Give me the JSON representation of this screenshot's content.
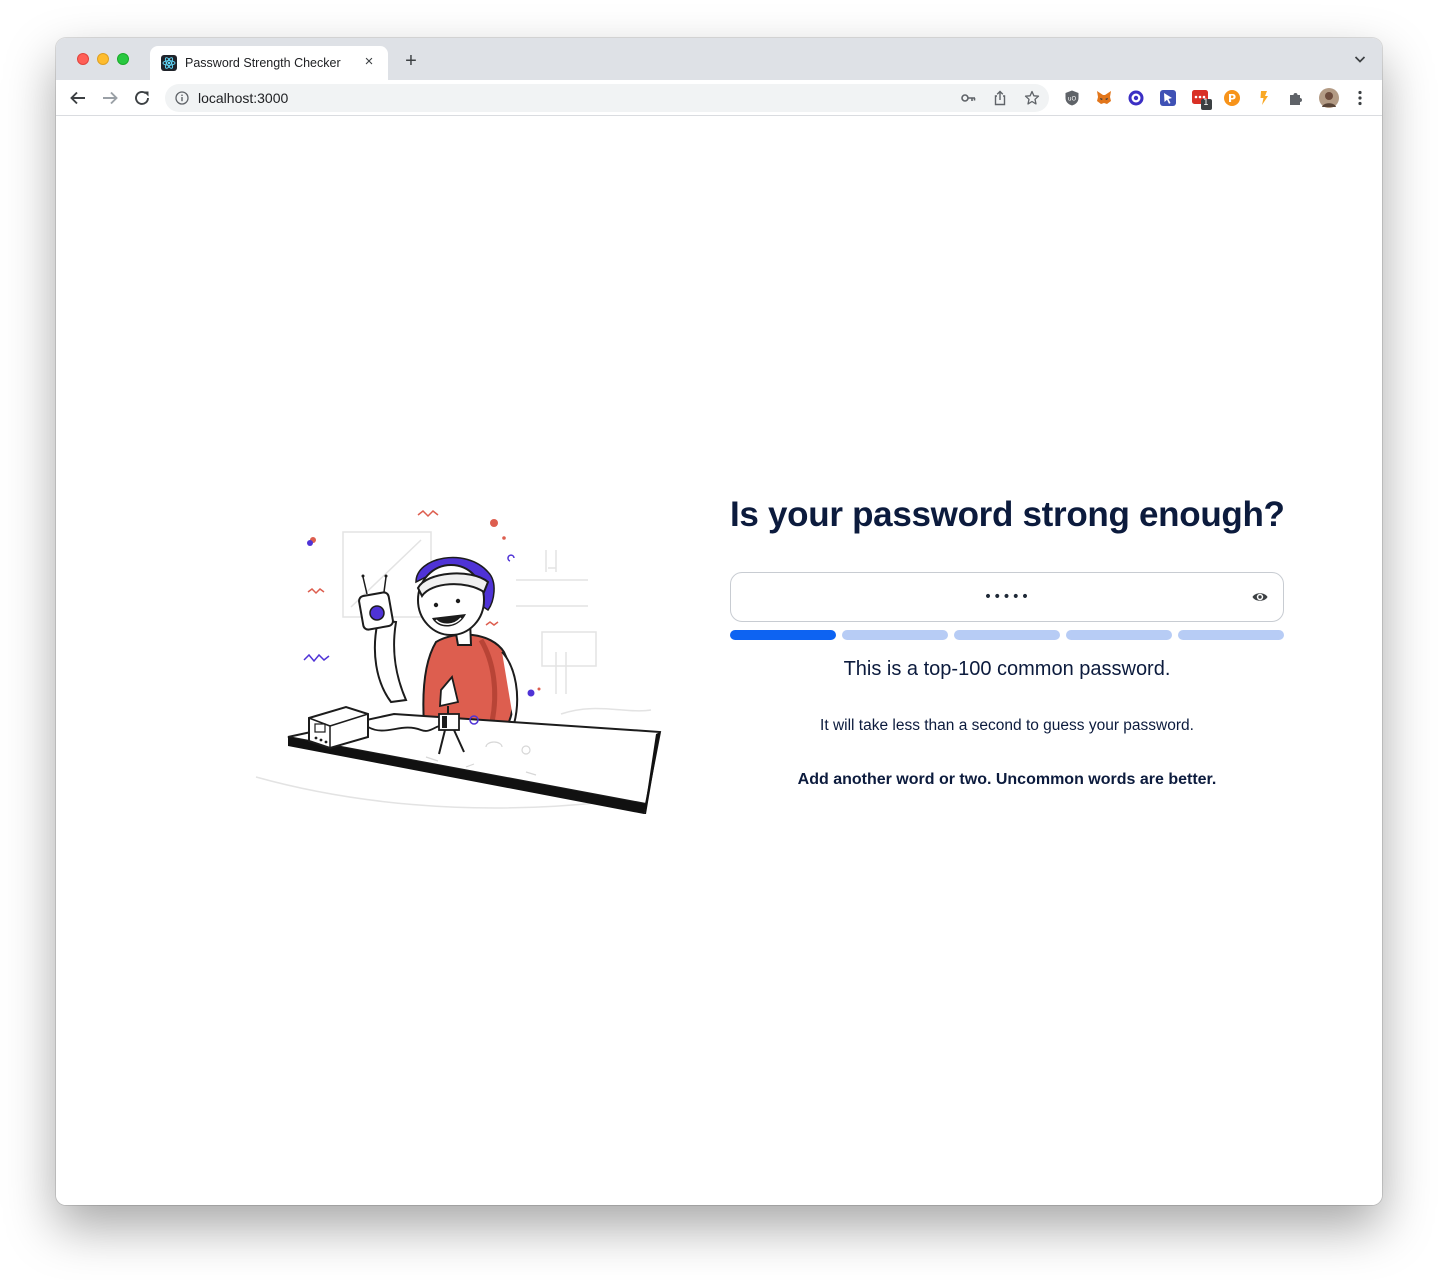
{
  "browser": {
    "tab_title": "Password Strength Checker",
    "tab_close": "×",
    "new_tab": "+",
    "url": "localhost:3000",
    "extension_badge": "1"
  },
  "page": {
    "headline": "Is your password strong enough?",
    "password_value": "•••••",
    "strength_segments_total": 5,
    "strength_segments_filled": 1,
    "warning": "This is a top-100 common password.",
    "crack_time": "It will take less than a second to guess your password.",
    "suggestion": "Add another word or two. Uncommon words are better."
  },
  "colors": {
    "headline": "#0c1b3d",
    "meter_on": "#0d63f2",
    "meter_off": "#b7ccf5",
    "accent_purple": "#4f33d6",
    "shirt": "#dd5e4f"
  }
}
